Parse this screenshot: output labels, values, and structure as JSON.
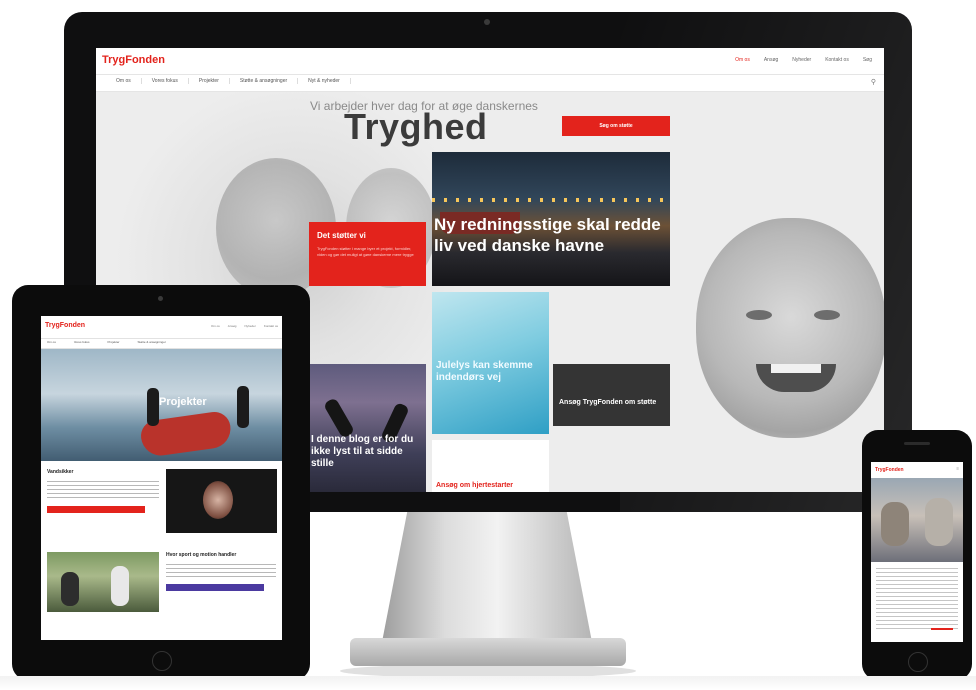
{
  "desktop": {
    "logo": "TrygFonden",
    "top_links": [
      "Om os",
      "Ansøg",
      "Nyheder",
      "Kontakt os",
      "Søg"
    ],
    "nav_items": [
      "Om os",
      "Vores fokus",
      "Projekter",
      "Støtte & ansøgninger",
      "Nyt & nyheder"
    ],
    "search_icon": "search-icon",
    "tagline": "Vi arbejder hver dag for at øge danskernes",
    "hero_title": "Tryghed",
    "cta_label": "Søg om støtte",
    "tiles": {
      "red_title": "Det støtter vi",
      "red_text": "TrygFonden støtter i mange byer et projekt, formidler, viden og gør det muligt at gøre danskerne mere trygge",
      "harbor": "Ny redningsstige skal redde liv ved danske havne",
      "jul": "Julelys kan skemme indendørs vej",
      "dark": "Ansøg TrygFonden om støtte",
      "climb": "I denne blog er for du ikke lyst til at sidde stille",
      "white": "Ansøg om hjertestarter"
    }
  },
  "tablet": {
    "logo": "TrygFonden",
    "hero_title": "Projekter",
    "section1_title": "Vandsikker",
    "section2_title": "Hvor sport og motion handler"
  },
  "phone": {
    "logo": "TrygFonden"
  },
  "colors": {
    "brand_red": "#e3231c",
    "purple_button": "#4b3aa0",
    "device_black": "#0c0c0c"
  }
}
